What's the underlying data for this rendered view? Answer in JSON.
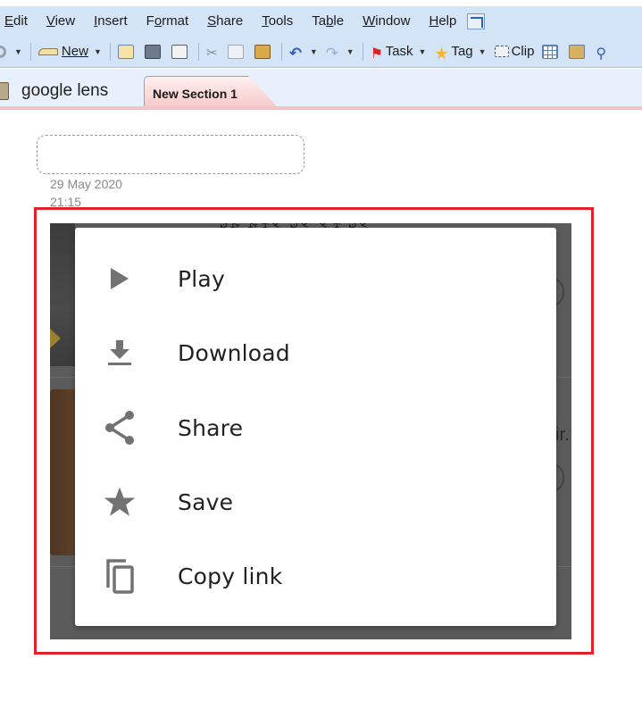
{
  "app": {
    "menubar": {
      "items": [
        {
          "label": "Edit",
          "underline": "E"
        },
        {
          "label": "View",
          "underline": "V"
        },
        {
          "label": "Insert",
          "underline": "I"
        },
        {
          "label": "Format",
          "underline": "o"
        },
        {
          "label": "Share",
          "underline": "S"
        },
        {
          "label": "Tools",
          "underline": "T"
        },
        {
          "label": "Table",
          "underline": "b"
        },
        {
          "label": "Window",
          "underline": "W"
        },
        {
          "label": "Help",
          "underline": "H"
        }
      ],
      "extra_icon": "dock-to-desktop-icon"
    },
    "toolbar": {
      "back_icon": "back-circle-icon",
      "new_label": "New",
      "icons": [
        "email-page-icon",
        "print-icon",
        "print-preview-icon",
        "cut-icon",
        "copy-icon",
        "paste-icon",
        "undo-icon",
        "redo-icon"
      ],
      "task_label": "Task",
      "tag_label": "Tag",
      "clip_label": "Clip",
      "trailing_icons": [
        "insert-table-icon",
        "research-icon",
        "more-icon"
      ]
    },
    "tabs": {
      "notebook_label": "google lens",
      "active_section": "New Section 1"
    },
    "page": {
      "title_placeholder": "",
      "date": "29 May 2020",
      "time": "21:15"
    },
    "highlight_color": "#e5202b"
  },
  "embedded_screenshot": {
    "background_text_fragment": "ir.",
    "share_menu": {
      "items": [
        {
          "label": "Play",
          "icon": "play-icon"
        },
        {
          "label": "Download",
          "icon": "download-icon"
        },
        {
          "label": "Share",
          "icon": "share-icon"
        },
        {
          "label": "Save",
          "icon": "star-icon"
        },
        {
          "label": "Copy link",
          "icon": "copy-link-icon"
        }
      ]
    }
  }
}
